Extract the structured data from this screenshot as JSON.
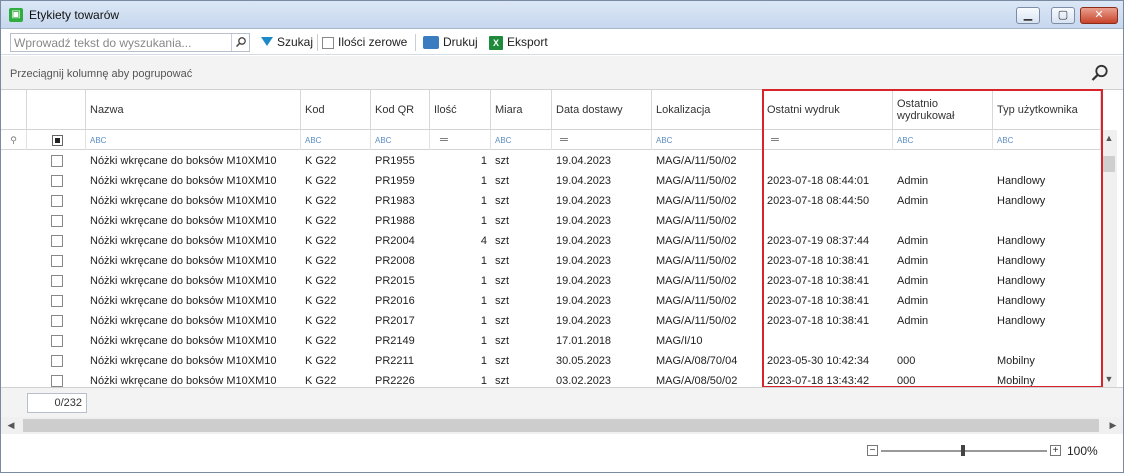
{
  "window": {
    "title": "Etykiety towarów",
    "minimize": "▁",
    "maximize": "▢",
    "close": "✕"
  },
  "toolbar": {
    "search_placeholder": "Wprowadź tekst do wyszukania...",
    "search_label": "Szukaj",
    "zero_qty_label": "Ilości zerowe",
    "print_label": "Drukuj",
    "export_label": "Eksport"
  },
  "group_hint": "Przeciągnij kolumnę aby pogrupować",
  "columns": [
    "Nazwa",
    "Kod",
    "Kod QR",
    "Ilość",
    "Miara",
    "Data dostawy",
    "Lokalizacja",
    "Ostatni wydruk",
    "Ostatnio wydrukował",
    "Typ użytkownika"
  ],
  "filter_markers": {
    "text": "ABC",
    "numeric": "═"
  },
  "rows": [
    {
      "nazwa": "Nóżki wkręcane do boksów M10XM10",
      "kod": "K G22",
      "kod_qr": "PR1955",
      "ilosc": "1",
      "miara": "szt",
      "data_dostawy": "19.04.2023",
      "lokalizacja": "MAG/A/11/50/02",
      "ostatni_wydruk": "",
      "ostatnio_wydrukowal": "",
      "typ_uzytkownika": ""
    },
    {
      "nazwa": "Nóżki wkręcane do boksów M10XM10",
      "kod": "K G22",
      "kod_qr": "PR1959",
      "ilosc": "1",
      "miara": "szt",
      "data_dostawy": "19.04.2023",
      "lokalizacja": "MAG/A/11/50/02",
      "ostatni_wydruk": "2023-07-18 08:44:01",
      "ostatnio_wydrukowal": "Admin",
      "typ_uzytkownika": "Handlowy"
    },
    {
      "nazwa": "Nóżki wkręcane do boksów M10XM10",
      "kod": "K G22",
      "kod_qr": "PR1983",
      "ilosc": "1",
      "miara": "szt",
      "data_dostawy": "19.04.2023",
      "lokalizacja": "MAG/A/11/50/02",
      "ostatni_wydruk": "2023-07-18 08:44:50",
      "ostatnio_wydrukowal": "Admin",
      "typ_uzytkownika": "Handlowy"
    },
    {
      "nazwa": "Nóżki wkręcane do boksów M10XM10",
      "kod": "K G22",
      "kod_qr": "PR1988",
      "ilosc": "1",
      "miara": "szt",
      "data_dostawy": "19.04.2023",
      "lokalizacja": "MAG/A/11/50/02",
      "ostatni_wydruk": "",
      "ostatnio_wydrukowal": "",
      "typ_uzytkownika": ""
    },
    {
      "nazwa": "Nóżki wkręcane do boksów M10XM10",
      "kod": "K G22",
      "kod_qr": "PR2004",
      "ilosc": "4",
      "miara": "szt",
      "data_dostawy": "19.04.2023",
      "lokalizacja": "MAG/A/11/50/02",
      "ostatni_wydruk": "2023-07-19 08:37:44",
      "ostatnio_wydrukowal": "Admin",
      "typ_uzytkownika": "Handlowy"
    },
    {
      "nazwa": "Nóżki wkręcane do boksów M10XM10",
      "kod": "K G22",
      "kod_qr": "PR2008",
      "ilosc": "1",
      "miara": "szt",
      "data_dostawy": "19.04.2023",
      "lokalizacja": "MAG/A/11/50/02",
      "ostatni_wydruk": "2023-07-18 10:38:41",
      "ostatnio_wydrukowal": "Admin",
      "typ_uzytkownika": "Handlowy"
    },
    {
      "nazwa": "Nóżki wkręcane do boksów M10XM10",
      "kod": "K G22",
      "kod_qr": "PR2015",
      "ilosc": "1",
      "miara": "szt",
      "data_dostawy": "19.04.2023",
      "lokalizacja": "MAG/A/11/50/02",
      "ostatni_wydruk": "2023-07-18 10:38:41",
      "ostatnio_wydrukowal": "Admin",
      "typ_uzytkownika": "Handlowy"
    },
    {
      "nazwa": "Nóżki wkręcane do boksów M10XM10",
      "kod": "K G22",
      "kod_qr": "PR2016",
      "ilosc": "1",
      "miara": "szt",
      "data_dostawy": "19.04.2023",
      "lokalizacja": "MAG/A/11/50/02",
      "ostatni_wydruk": "2023-07-18 10:38:41",
      "ostatnio_wydrukowal": "Admin",
      "typ_uzytkownika": "Handlowy"
    },
    {
      "nazwa": "Nóżki wkręcane do boksów M10XM10",
      "kod": "K G22",
      "kod_qr": "PR2017",
      "ilosc": "1",
      "miara": "szt",
      "data_dostawy": "19.04.2023",
      "lokalizacja": "MAG/A/11/50/02",
      "ostatni_wydruk": "2023-07-18 10:38:41",
      "ostatnio_wydrukowal": "Admin",
      "typ_uzytkownika": "Handlowy"
    },
    {
      "nazwa": "Nóżki wkręcane do boksów M10XM10",
      "kod": "K G22",
      "kod_qr": "PR2149",
      "ilosc": "1",
      "miara": "szt",
      "data_dostawy": "17.01.2018",
      "lokalizacja": "MAG/I/10",
      "ostatni_wydruk": "",
      "ostatnio_wydrukowal": "",
      "typ_uzytkownika": ""
    },
    {
      "nazwa": "Nóżki wkręcane do boksów M10XM10",
      "kod": "K G22",
      "kod_qr": "PR2211",
      "ilosc": "1",
      "miara": "szt",
      "data_dostawy": "30.05.2023",
      "lokalizacja": "MAG/A/08/70/04",
      "ostatni_wydruk": "2023-05-30 10:42:34",
      "ostatnio_wydrukowal": "000",
      "typ_uzytkownika": "Mobilny"
    },
    {
      "nazwa": "Nóżki wkręcane do boksów M10XM10",
      "kod": "K G22",
      "kod_qr": "PR2226",
      "ilosc": "1",
      "miara": "szt",
      "data_dostawy": "03.02.2023",
      "lokalizacja": "MAG/A/08/50/02",
      "ostatni_wydruk": "2023-07-18 13:43:42",
      "ostatnio_wydrukowal": "000",
      "typ_uzytkownika": "Mobilny"
    }
  ],
  "footer": {
    "count": "0/232"
  },
  "zoom": {
    "minus": "−",
    "plus": "+",
    "label": "100%"
  },
  "colors": {
    "highlight": "#d9232a",
    "accent": "#1d89c7"
  }
}
